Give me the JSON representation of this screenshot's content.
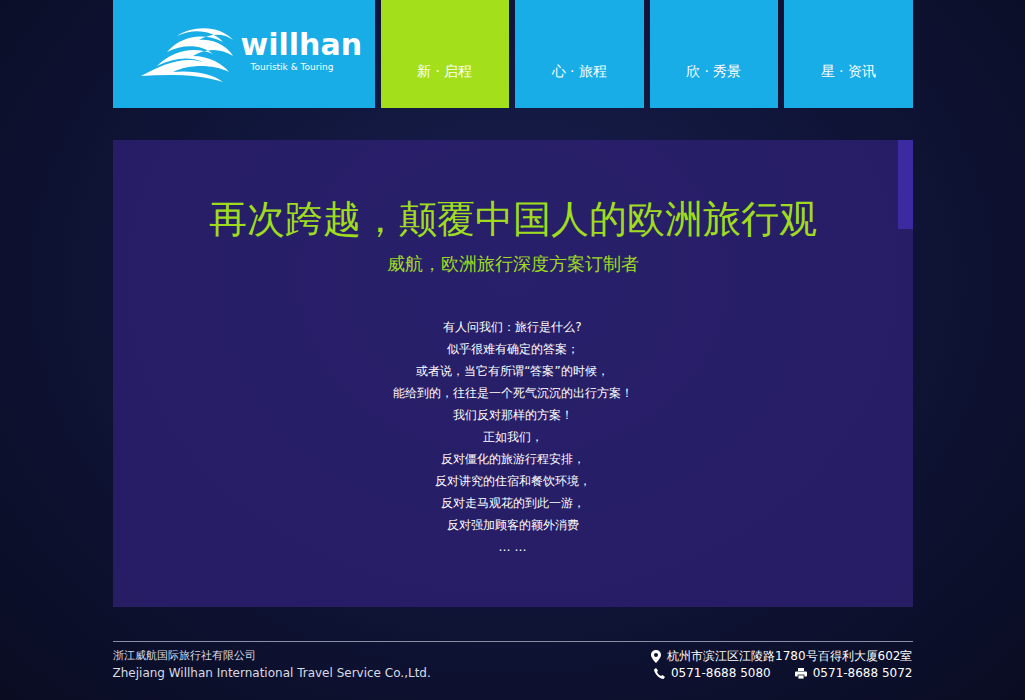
{
  "logo": {
    "name": "willhan",
    "tagline": "Touristik & Touring"
  },
  "nav": [
    {
      "label": "新 · 启程",
      "selected": true
    },
    {
      "label": "心 · 旅程",
      "selected": false
    },
    {
      "label": "欣 · 秀景",
      "selected": false
    },
    {
      "label": "星 · 资讯",
      "selected": false
    }
  ],
  "hero": {
    "title": "再次跨越，颠覆中国人的欧洲旅行观",
    "subtitle": "威航，欧洲旅行深度方案订制者",
    "lines": [
      "有人问我们：旅行是什么?",
      "似乎很难有确定的答案；",
      "或者说，当它有所谓“答案”的时候，",
      "能给到的，往往是一个死气沉沉的出行方案！",
      "我们反对那样的方案！",
      "正如我们，",
      "反对僵化的旅游行程安排，",
      "反对讲究的住宿和餐饮环境，",
      "反对走马观花的到此一游，",
      "反对强加顾客的额外消费",
      "… …"
    ]
  },
  "scrollbar": {
    "level": 0.19
  },
  "footer": {
    "company_cn": "浙江威航国际旅行社有限公司",
    "company_en": "Zhejiang Willhan International Travel Service Co.,Ltd.",
    "address": "杭州市滨江区江陵路1780号百得利大厦602室",
    "phone": "0571-8688 5080",
    "fax": "0571-8688 5072"
  }
}
